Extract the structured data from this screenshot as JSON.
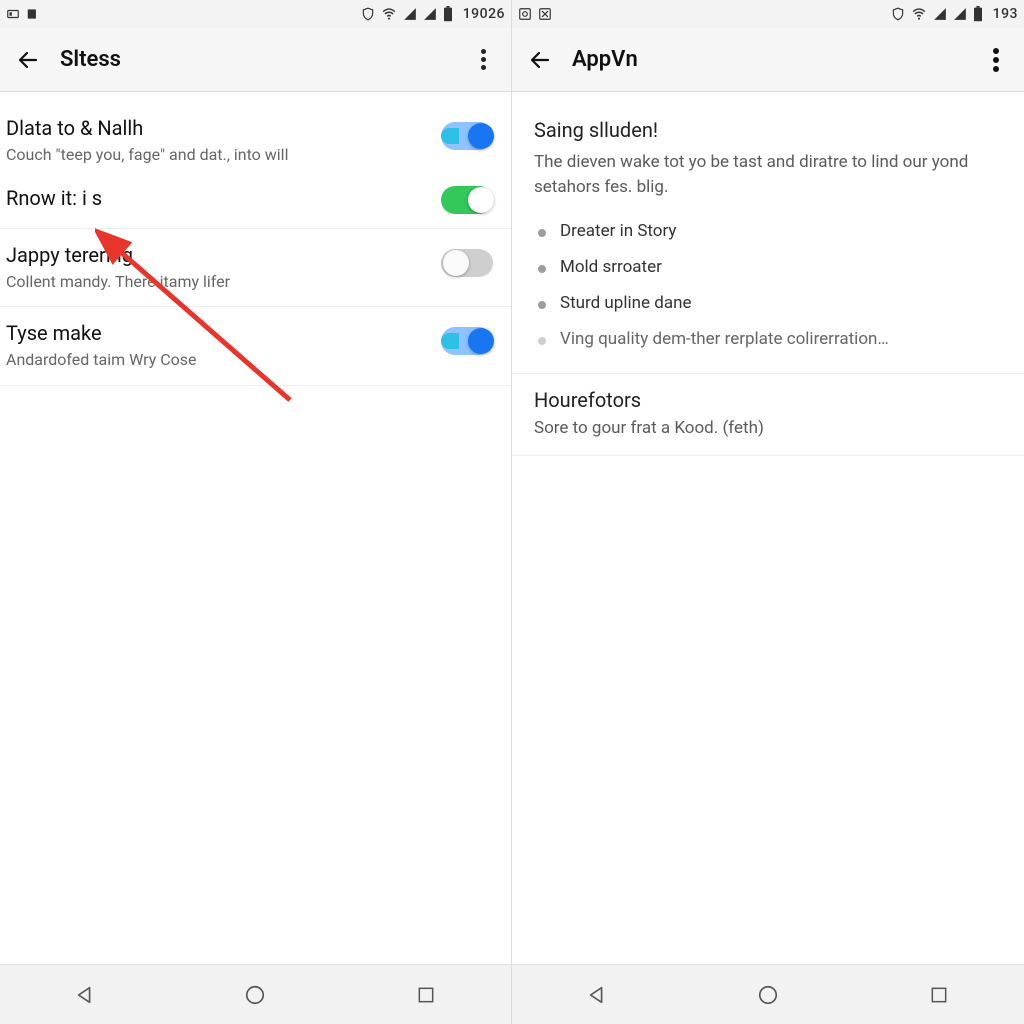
{
  "left": {
    "statusbar": {
      "time": "19026"
    },
    "appbar": {
      "title": "Sltess"
    },
    "rows": [
      {
        "title": "Dlata to & Nallh",
        "sub": "Couch \"teep you, fage\" and dat., into will",
        "toggle": "blue"
      },
      {
        "title": "Rnow it: i s",
        "sub": "",
        "toggle": "green"
      },
      {
        "title": "Jappy terering",
        "sub": "Collent mandy.  There itamy lifer",
        "toggle": "off"
      },
      {
        "title": "Tyse make",
        "sub": "Andardofed taim Wry Cose",
        "toggle": "blue"
      }
    ]
  },
  "right": {
    "statusbar": {
      "time": "193"
    },
    "appbar": {
      "title": "AppVn"
    },
    "info": {
      "title": "Saing slluden!",
      "desc": "The dieven wake tot yo be tast and diratre to lind our yond setahors fes. blig.",
      "bullets": [
        "Dreater in Story",
        "Mold srroater",
        "Sturd upline dane",
        "Ving quality dem-ther rerplate colirerration…"
      ]
    },
    "section2": {
      "title": "Hourefotors",
      "sub": "Sore to gour frat a Kood. (feth)"
    }
  }
}
